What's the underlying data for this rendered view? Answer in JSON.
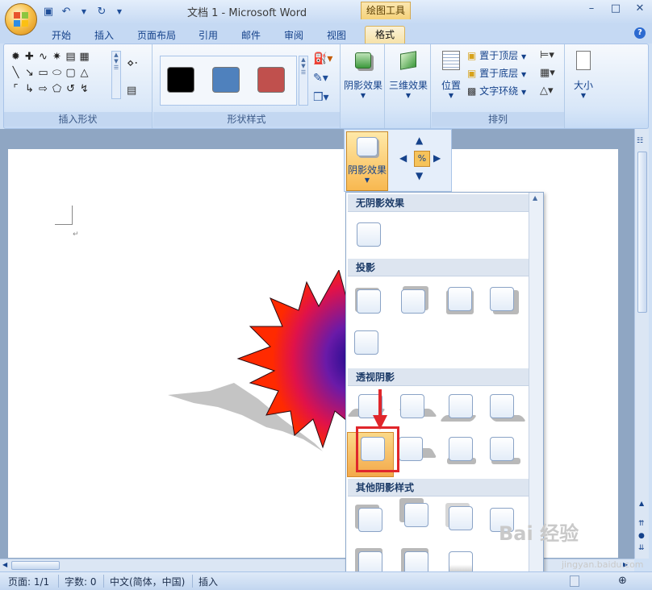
{
  "window": {
    "title": "文档 1 - Microsoft Word",
    "context_tab_group": "绘图工具",
    "controls": [
      "–",
      "□",
      "✕"
    ]
  },
  "tabs": [
    {
      "label": "开始"
    },
    {
      "label": "插入"
    },
    {
      "label": "页面布局"
    },
    {
      "label": "引用"
    },
    {
      "label": "邮件"
    },
    {
      "label": "审阅"
    },
    {
      "label": "视图"
    },
    {
      "label": "格式",
      "active": true
    }
  ],
  "ribbon": {
    "insert_shapes": {
      "label": "插入形状"
    },
    "shape_styles": {
      "label": "形状样式",
      "swatches": [
        "#000000",
        "#4f81bd",
        "#c0504d"
      ]
    },
    "shadow_effects": {
      "label": "阴影效果"
    },
    "threed_effects": {
      "label": "三维效果"
    },
    "arrange": {
      "label": "排列",
      "position": "位置",
      "bring_to_front": "置于顶层",
      "send_to_back": "置于底层",
      "text_wrapping": "文字环绕"
    },
    "size": {
      "label": "大小"
    }
  },
  "shadow_menu": {
    "button_label": "阴影效果",
    "sections": [
      {
        "title": "无阴影效果"
      },
      {
        "title": "投影"
      },
      {
        "title": "透视阴影"
      },
      {
        "title": "其他阴影样式"
      }
    ]
  },
  "statusbar": {
    "page": "页面: 1/1",
    "words": "字数: 0",
    "language": "中文(简体，中国)",
    "mode": "插入"
  },
  "watermark": {
    "brand": "Bai 经验",
    "url": "jingyan.baidu.com"
  },
  "colors": {
    "accent": "#f6c35a",
    "highlight_box": "#e0262b",
    "ribbon": "#d9e7f8"
  }
}
